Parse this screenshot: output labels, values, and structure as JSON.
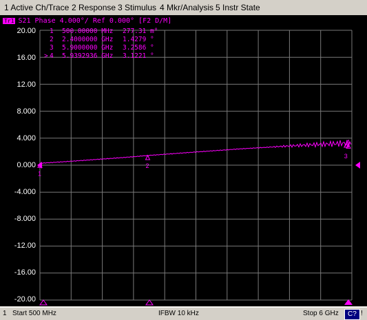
{
  "menu": {
    "items": [
      "1 Active Ch/Trace",
      "2 Response",
      "3 Stimulus",
      "4 Mkr/Analysis",
      "5 Instr State"
    ]
  },
  "trace": {
    "badge": "Tr1",
    "header": "S21 Phase 4.000°/ Ref 0.000° [F2 D/M]",
    "color": "#ff00ff"
  },
  "markers": [
    {
      "id": "1",
      "prefix": " ",
      "freq": "500.00000 MHz",
      "value": "277.31 m°"
    },
    {
      "id": "2",
      "prefix": " ",
      "freq": "2.4000000 GHz",
      "value": "1.4279 °"
    },
    {
      "id": "3",
      "prefix": " ",
      "freq": "5.9000000 GHz",
      "value": "3.2586 °"
    },
    {
      "id": "4",
      "prefix": ">",
      "freq": "5.9392936 GHz",
      "value": "3.1221 °"
    }
  ],
  "y_ticks": [
    "20.00",
    "16.00",
    "12.00",
    "8.000",
    "4.000",
    "0.000",
    "-4.000",
    "-8.000",
    "-12.00",
    "-16.00",
    "-20.00"
  ],
  "chart_data": {
    "type": "line",
    "series": [
      {
        "x_mhz": [
          500,
          1000,
          1500,
          2000,
          2400,
          3000,
          3500,
          4000,
          4500,
          5000,
          5500,
          5900,
          5939.3,
          6000
        ],
        "y_deg": [
          0.28,
          0.55,
          0.85,
          1.15,
          1.43,
          1.8,
          2.1,
          2.4,
          2.65,
          2.9,
          3.1,
          3.26,
          3.12,
          3.15
        ]
      }
    ],
    "xlim": [
      500,
      6000
    ],
    "ylim": [
      -20,
      20
    ],
    "scale_per_div": 4,
    "ref_value": 0,
    "grid": true
  },
  "status": {
    "channel": "1",
    "start": "Start 500 MHz",
    "ifbw": "IFBW 10 kHz",
    "stop": "Stop 6 GHz",
    "c7": "C?",
    "end": "!"
  }
}
